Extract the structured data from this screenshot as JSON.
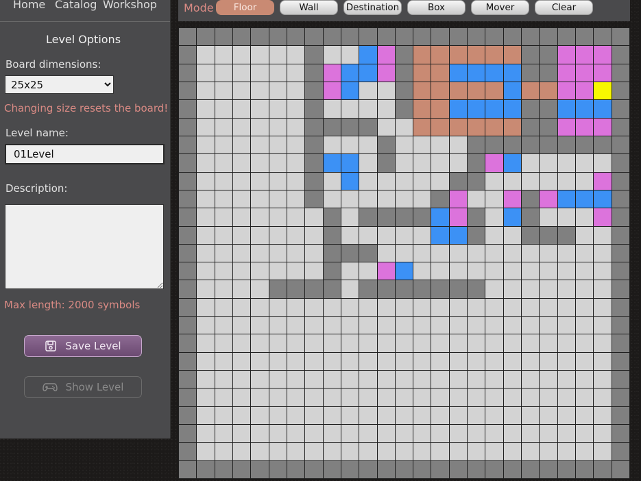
{
  "nav": {
    "home": "Home",
    "catalog": "Catalog",
    "workshop": "Workshop"
  },
  "options": {
    "title": "Level Options",
    "board_dim_label": "Board dimensions:",
    "board_dim_value": "25x25",
    "board_dim_options": [
      "25x25"
    ],
    "warning": "Changing size resets the board!",
    "level_name_label": "Level name:",
    "level_name_value": "01Level",
    "description_label": "Description:",
    "description_value": "",
    "max_length": "Max length: 2000 symbols",
    "save_label": "Save Level",
    "show_label": "Show Level"
  },
  "toolbar": {
    "mode_label": "Mode",
    "active_mode": "Floor",
    "modes": [
      "Floor",
      "Wall",
      "Destination",
      "Box",
      "Mover",
      "Clear"
    ]
  },
  "icons": {
    "save": "floppy-disk-icon",
    "show": "gamepad-icon"
  },
  "colors": {
    "wall": "#808080",
    "floor": "#d3d3d3",
    "box": "#3c91f5",
    "destination": "#dc73dc",
    "mover": "#c98a73",
    "player": "#f8f800",
    "warning_text": "#d98a84",
    "active_mode": "#c98a73"
  },
  "board": {
    "size": 25,
    "legend": {
      "W": "wall",
      "F": "floor",
      "B": "box",
      "P": "destination",
      "R": "mover",
      "Y": "yellow"
    },
    "rows": [
      "WWWWWWWWWWWWWWWWWWWWWWWWW",
      "WFFFFFFWFFBPWRRRRRRWWPPPW",
      "WFFFFFFWPBBPWRRBBBBWWPPPW",
      "WFFFFFFWPBFFWRRRRRBRRPPYW",
      "WFFFFFFWFFFFWRRBBBBWWBBBW",
      "WFFFFFFWWWWFFRRRRRRWWPPPW",
      "WFFFFFFWFFFWFFFFWWWWWWWWW",
      "WFFFFFFWBBFWFFFFWPBFFFFFW",
      "WFFFFFFWFBFFFFFWWFFFFFFPW",
      "WFFFFFFWFFFFFFWPFFPWPBBBW",
      "WFFFFFFFWFWWWWBPWFBWFFFPW",
      "WFFFFFFFWFFFFFBBWFFWWWFFW",
      "WFFFFFFFWWWFFFFFFFFFFFFFW",
      "WFFFFFFFWFFPBFFFFFFFFFFFW",
      "WFFFFWWWWFWWWWWWWFFFFFFFW",
      "WFFFFFFFFFFFFFFFFFFFFFFFW",
      "WFFFFFFFFFFFFFFFFFFFFFFFW",
      "WFFFFFFFFFFFFFFFFFFFFFFFW",
      "WFFFFFFFFFFFFFFFFFFFFFFFW",
      "WFFFFFFFFFFFFFFFFFFFFFFFW",
      "WFFFFFFFFFFFFFFFFFFFFFFFW",
      "WFFFFFFFFFFFFFFFFFFFFFFFW",
      "WFFFFFFFFFFFFFFFFFFFFFFFW",
      "WFFFFFFFFFFFFFFFFFFFFFFFW",
      "WWWWWWWWWWWWWWWWWWWWWWWWW"
    ]
  }
}
